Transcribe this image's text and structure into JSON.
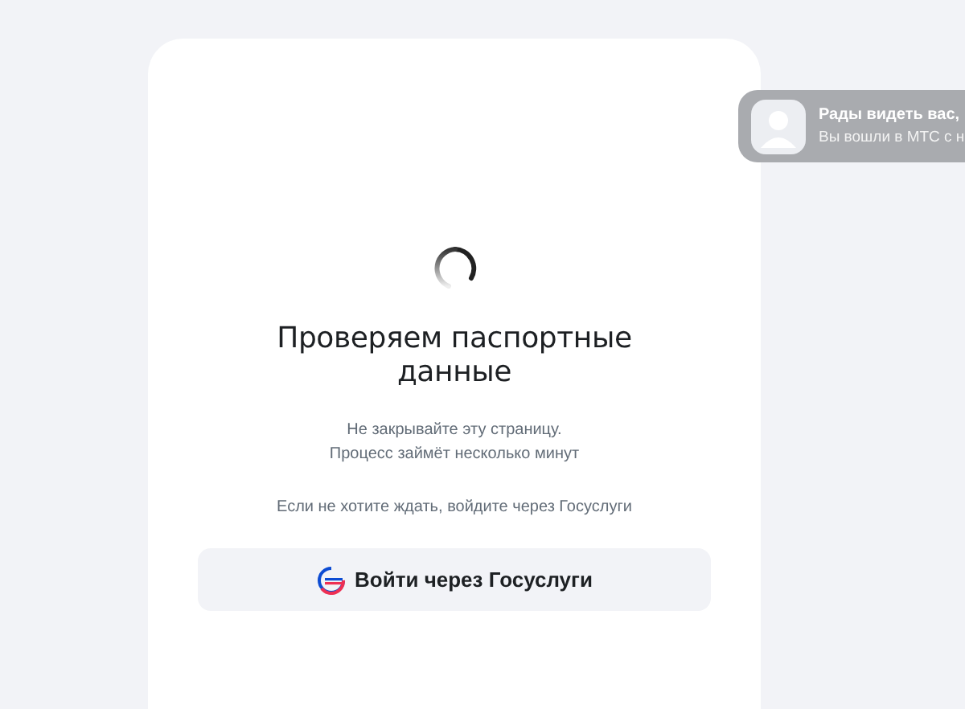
{
  "card": {
    "title": "Проверяем паспортные данные",
    "notice_lines": [
      "Не закрывайте эту страницу.",
      "Процесс займёт несколько минут"
    ],
    "hint": "Если не хотите ждать, войдите через Госуслуги",
    "button": "Войти через Госуслуги"
  },
  "toast": {
    "title": "Рады видеть вас,",
    "message": "Вы вошли в МТС с н"
  }
}
